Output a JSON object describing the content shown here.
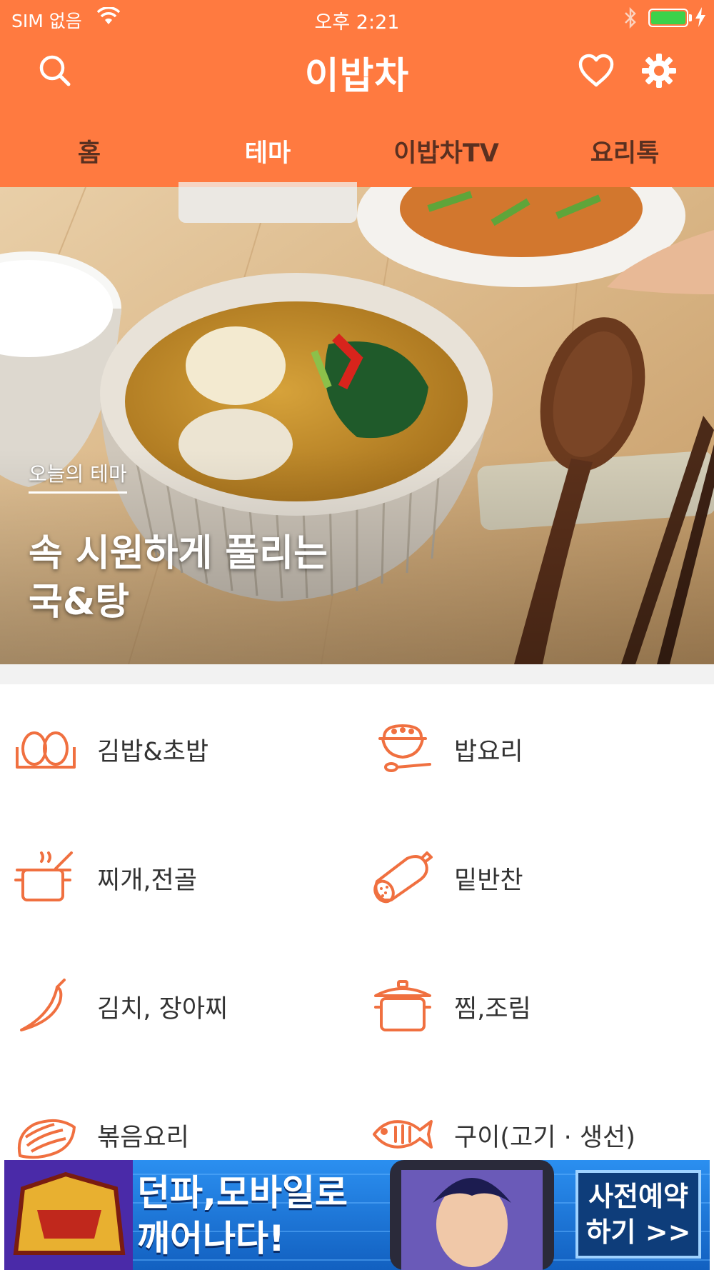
{
  "status_bar": {
    "carrier": "SIM 없음",
    "time": "오후 2:21"
  },
  "header": {
    "logo": "이밥차",
    "icons": [
      "search-icon",
      "heart-icon",
      "gear-icon"
    ],
    "colors": {
      "background": "#ff7a40",
      "active_tab_underline": "#f6d4c3",
      "icon_orange": "#f07040"
    }
  },
  "tabs": [
    {
      "label": "홈",
      "active": false
    },
    {
      "label": "테마",
      "active": true
    },
    {
      "label": "이밥차TV",
      "active": false
    },
    {
      "label": "요리톡",
      "active": false
    }
  ],
  "hero": {
    "subtitle": "오늘의 테마",
    "title": "속 시원하게 풀리는\n국&탕"
  },
  "categories": [
    {
      "label": "김밥&초밥",
      "icon": "gimbap-icon"
    },
    {
      "label": "밥요리",
      "icon": "rice-bowl-icon"
    },
    {
      "label": "찌개,전골",
      "icon": "stew-pot-icon"
    },
    {
      "label": "밑반찬",
      "icon": "sausage-icon"
    },
    {
      "label": "김치, 장아찌",
      "icon": "chili-pepper-icon"
    },
    {
      "label": "찜,조림",
      "icon": "steam-pot-icon"
    },
    {
      "label": "볶음요리",
      "icon": "salmon-icon"
    },
    {
      "label": "구이(고기 · 생선)",
      "icon": "fish-icon"
    }
  ],
  "ad": {
    "headline": "던파,모바일로\n깨어나다!",
    "cta": "사전예약\n하기 >>"
  }
}
